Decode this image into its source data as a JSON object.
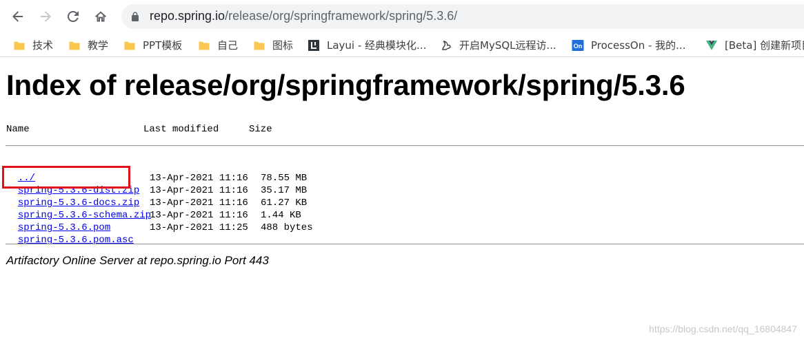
{
  "browser": {
    "url_host": "repo.spring.io",
    "url_path": "/release/org/springframework/spring/5.3.6/",
    "bookmarks": [
      {
        "label": "技术",
        "icon": "folder-icon"
      },
      {
        "label": "教学",
        "icon": "folder-icon"
      },
      {
        "label": "PPT模板",
        "icon": "folder-icon"
      },
      {
        "label": "自己",
        "icon": "folder-icon"
      },
      {
        "label": "图标",
        "icon": "folder-icon"
      },
      {
        "label": "Layui - 经典模块化...",
        "icon": "layui-icon"
      },
      {
        "label": "开启MySQL远程访...",
        "icon": "squirrel-icon"
      },
      {
        "label": "ProcessOn - 我的...",
        "icon": "processon-icon"
      },
      {
        "label": "[Beta] 创建新项目",
        "icon": "vue-icon"
      }
    ]
  },
  "page": {
    "title": "Index of release/org/springframework/spring/5.3.6",
    "columns": {
      "name": "Name",
      "modified": "Last modified",
      "size": "Size"
    },
    "parent_link": "../",
    "files": [
      {
        "name": "spring-5.3.6-dist.zip",
        "modified": "13-Apr-2021 11:16",
        "size": "78.55 MB"
      },
      {
        "name": "spring-5.3.6-docs.zip",
        "modified": "13-Apr-2021 11:16",
        "size": "35.17 MB"
      },
      {
        "name": "spring-5.3.6-schema.zip",
        "modified": "13-Apr-2021 11:16",
        "size": "61.27 KB"
      },
      {
        "name": "spring-5.3.6.pom",
        "modified": "13-Apr-2021 11:16",
        "size": "1.44 KB"
      },
      {
        "name": "spring-5.3.6.pom.asc",
        "modified": "13-Apr-2021 11:25",
        "size": "488 bytes"
      }
    ],
    "footer": "Artifactory Online Server at repo.spring.io Port 443",
    "highlight_color": "#e0101a"
  },
  "watermark": "https://blog.csdn.net/qq_16804847"
}
